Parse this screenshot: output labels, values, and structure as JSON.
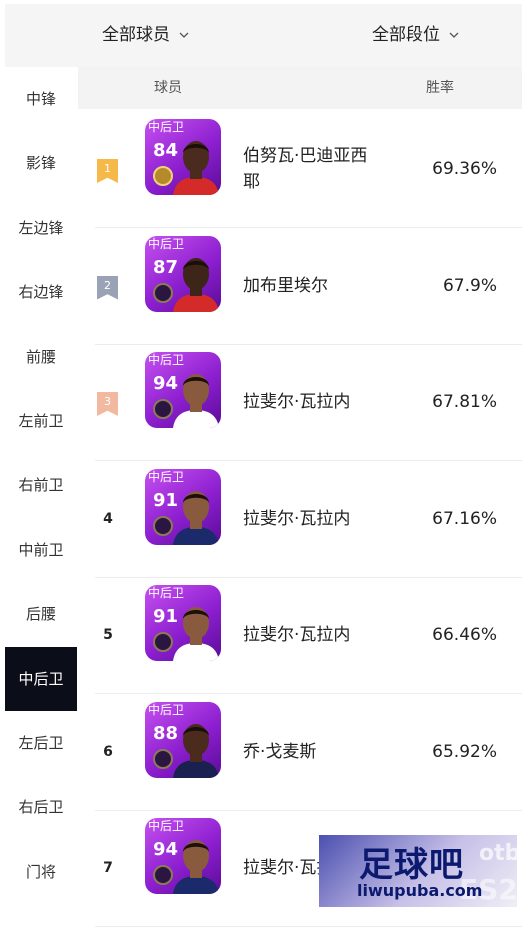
{
  "filters": {
    "players_label": "全部球员",
    "rank_label": "全部段位"
  },
  "sidebar": {
    "items": [
      {
        "label": "中锋"
      },
      {
        "label": "影锋"
      },
      {
        "label": "左边锋"
      },
      {
        "label": "右边锋"
      },
      {
        "label": "前腰"
      },
      {
        "label": "左前卫"
      },
      {
        "label": "右前卫"
      },
      {
        "label": "中前卫"
      },
      {
        "label": "后腰"
      },
      {
        "label": "中后卫",
        "active": true
      },
      {
        "label": "左后卫"
      },
      {
        "label": "右后卫"
      },
      {
        "label": "门将"
      }
    ]
  },
  "table": {
    "col_player": "球员",
    "col_winrate": "胜率",
    "rows": [
      {
        "rank": "1",
        "position": "中后卫",
        "rating": "84",
        "name": "伯努瓦·巴迪亚西耶",
        "winrate": "69.36%",
        "ribbon_color": "#f7b84a",
        "badge": "gold",
        "skin": "#4a2b1e",
        "jersey": "#d42a2a"
      },
      {
        "rank": "2",
        "position": "中后卫",
        "rating": "87",
        "name": "加布里埃尔",
        "winrate": "67.9%",
        "ribbon_color": "#9aa3b5",
        "badge": "dark",
        "skin": "#3d2519",
        "jersey": "#d42a2a"
      },
      {
        "rank": "3",
        "position": "中后卫",
        "rating": "94",
        "name": "拉斐尔·瓦拉内",
        "winrate": "67.81%",
        "ribbon_color": "#f0b9a0",
        "badge": "dark",
        "skin": "#8a5a3e",
        "jersey": "#ffffff"
      },
      {
        "rank": "4",
        "position": "中后卫",
        "rating": "91",
        "name": "拉斐尔·瓦拉内",
        "winrate": "67.16%",
        "badge": "dark",
        "skin": "#8a5a3e",
        "jersey": "#1a2a6a"
      },
      {
        "rank": "5",
        "position": "中后卫",
        "rating": "91",
        "name": "拉斐尔·瓦拉内",
        "winrate": "66.46%",
        "badge": "dark",
        "skin": "#8a5a3e",
        "jersey": "#ffffff"
      },
      {
        "rank": "6",
        "position": "中后卫",
        "rating": "88",
        "name": "乔·戈麦斯",
        "winrate": "65.92%",
        "badge": "dark",
        "skin": "#4a2b1e",
        "jersey": "#1a2050"
      },
      {
        "rank": "7",
        "position": "中后卫",
        "rating": "94",
        "name": "拉斐尔·瓦拉内",
        "winrate": "",
        "badge": "dark",
        "skin": "#8a5a3e",
        "jersey": "#1a2a6a"
      }
    ]
  },
  "watermark": {
    "site_name": "足球吧",
    "url": "liwupuba.com"
  }
}
